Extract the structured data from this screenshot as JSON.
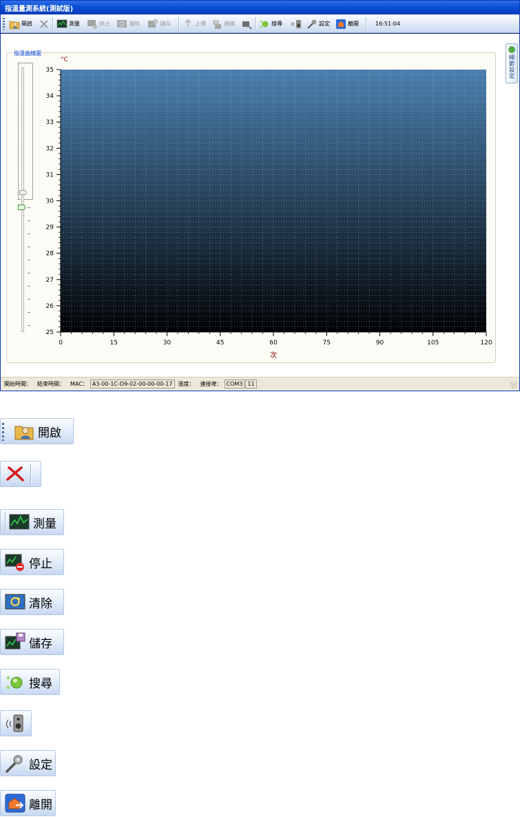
{
  "window": {
    "title": "指溫量測系統(測試版)"
  },
  "toolbar": {
    "open_label": "開啟",
    "measure_label": "測量",
    "stop_label": "停止",
    "clear_label": "清除",
    "save_label": "儲存",
    "upload_label": "上傳",
    "connect_label": "連線",
    "search_label": "搜尋",
    "settings_label": "設定",
    "exit_label": "離開",
    "clock": "16:51:04"
  },
  "panel": {
    "group_title": "指溫曲線圖",
    "side_tab": "細節設定"
  },
  "statusbar": {
    "start_label": "開始時間：",
    "end_label": "結束時間：",
    "mac_label": "MAC：",
    "mac_value": "A3-00-1C-D9-02-00-00-00-17",
    "temp_label": "溫度：",
    "port_label": "連接埠：",
    "port_value": "COM3",
    "port_num": "11"
  },
  "chart_data": {
    "type": "line",
    "title": "",
    "xlabel": "次",
    "ylabel": "°C",
    "xlim": [
      0,
      120
    ],
    "ylim": [
      25,
      35
    ],
    "x_ticks": [
      0,
      15,
      30,
      45,
      60,
      75,
      90,
      105,
      120
    ],
    "y_ticks": [
      25,
      26,
      27,
      28,
      29,
      30,
      31,
      32,
      33,
      34,
      35
    ],
    "grid": true,
    "series": []
  },
  "legend_buttons": {
    "open_label": "開啟",
    "measure_label": "測量",
    "stop_label": "停止",
    "clear_label": "清除",
    "save_label": "儲存",
    "search_label": "搜尋",
    "settings_label": "設定",
    "exit_label": "離開"
  },
  "colors": {
    "plot_top": "#4a7fae",
    "plot_bottom": "#020304",
    "axis_label": "#8b0000",
    "title_bar": "#0a4fd6"
  }
}
